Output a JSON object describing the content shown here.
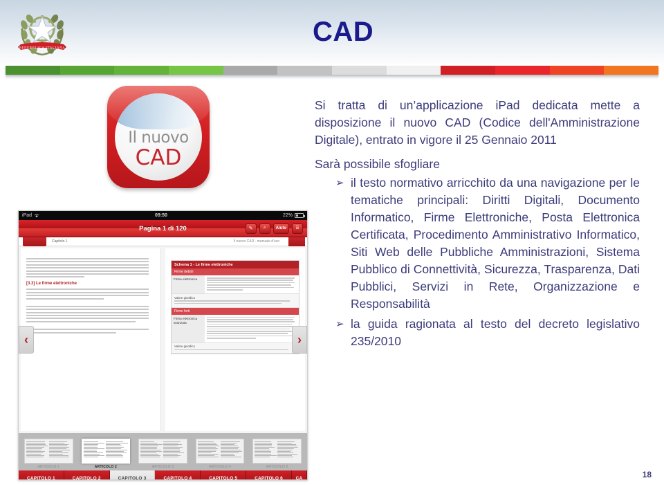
{
  "header": {
    "emblem_name": "italian-republic-emblem",
    "title": "CAD",
    "title_color": "#1a1a8c"
  },
  "flag_strip": {
    "segments": [
      "#4c9130",
      "#57a633",
      "#63b23a",
      "#76c546",
      "#a9a9a9",
      "#c2c2c2",
      "#dcdcdc",
      "#f0f0f0",
      "#d11f26",
      "#e8262b",
      "#ee4424",
      "#f47521"
    ]
  },
  "app_icon": {
    "name": "il-nuovo-cad-app-icon",
    "line1": "Il nuovo",
    "line2": "CAD",
    "bg_color": "#d21f22",
    "line2_color": "#c4262c"
  },
  "ipad_screenshot": {
    "status_bar": {
      "device": "iPad",
      "wifi_icon": "wifi-icon",
      "time": "09:50",
      "battery": "22%"
    },
    "toolbar": {
      "title": "Pagina 1 di 120",
      "buttons": [
        {
          "name": "bookmark-pen-icon",
          "label": "✎"
        },
        {
          "name": "search-icon",
          "label": "⌕"
        },
        {
          "name": "help-button",
          "label": "Aiuto"
        },
        {
          "name": "library-book-icon",
          "label": "⌸"
        }
      ]
    },
    "tabs": {
      "left_label": "Capitolo 1",
      "right_label": "Il nuovo CAD - manuale d'uso"
    },
    "left_page": {
      "heading": "[3.3] Le firme elettroniche"
    },
    "right_page": {
      "schema_title": "Schema 1 - Le firme elettroniche",
      "section_1": "Firme deboli",
      "row_1_label": "Firma elettronica",
      "note_1": "Valore giuridico",
      "section_2": "Firme forti",
      "row_2_label": "Firma elettronica avanzata",
      "note_2": "Valore giuridico"
    },
    "nav": {
      "prev": "‹",
      "next": "›"
    },
    "thumbnails": [
      {
        "label": "ARTICOLO 1",
        "active": false
      },
      {
        "label": "ARTICOLO 2",
        "active": true
      },
      {
        "label": "ARTICOLO 3",
        "active": false
      },
      {
        "label": "ARTICOLO 4",
        "active": false
      },
      {
        "label": "ARTICOLO 5",
        "active": false
      }
    ],
    "chapters": [
      {
        "label": "CAPITOLO 1",
        "active": false
      },
      {
        "label": "CAPITOLO 2",
        "active": false
      },
      {
        "label": "CAPITOLO 3",
        "active": true
      },
      {
        "label": "CAPITOLO 4",
        "active": false
      },
      {
        "label": "CAPITOLO 5",
        "active": false
      },
      {
        "label": "CAPITOLO 6",
        "active": false
      },
      {
        "label": "CA",
        "active": false
      }
    ]
  },
  "content": {
    "paragraph_1": "Si tratta di un’applicazione iPad dedicata mette a disposizione il nuovo CAD (Codice dell'Amministrazione Digitale), entrato in vigore il 25 Gennaio 2011",
    "paragraph_2": "Sarà possibile sfogliare",
    "bullet_symbol": "➢",
    "bullets": [
      "il testo normativo arricchito da una navigazione per le tematiche principali: Diritti Digitali, Documento Informatico, Firme Elettroniche, Posta Elettronica Certificata, Procedimento Amministrativo Informatico, Siti Web delle Pubbliche Amministrazioni, Sistema Pubblico di Connettività, Sicurezza, Trasparenza, Dati Pubblici, Servizi in Rete, Organizzazione e Responsabilità",
      "la guida ragionata al testo del decreto legislativo 235/2010"
    ],
    "text_color": "#3b3b7a"
  },
  "page_number": "18"
}
